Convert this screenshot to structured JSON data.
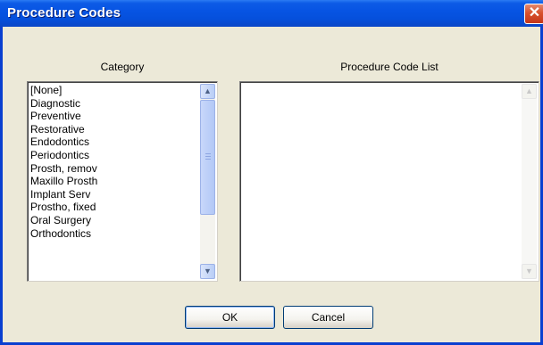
{
  "window": {
    "title": "Procedure Codes",
    "close_glyph": "✕"
  },
  "labels": {
    "category": "Category",
    "procedure_list": "Procedure Code List"
  },
  "category_items": [
    "[None]",
    "Diagnostic",
    "Preventive",
    "Restorative",
    "Endodontics",
    "Periodontics",
    "Prosth, remov",
    "Maxillo Prosth",
    "Implant Serv",
    "Prostho, fixed",
    "Oral Surgery",
    "Orthodontics"
  ],
  "procedure_items": [],
  "buttons": {
    "ok": "OK",
    "cancel": "Cancel"
  }
}
